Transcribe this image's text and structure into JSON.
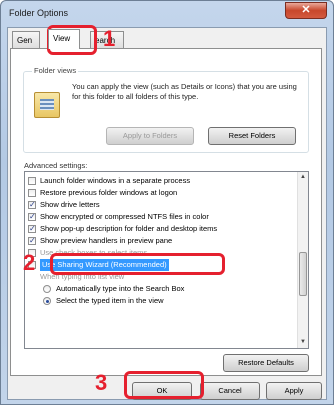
{
  "window": {
    "title": "Folder Options",
    "close_glyph": "✕"
  },
  "tabs": [
    {
      "label": "Gen"
    },
    {
      "label": "View"
    },
    {
      "label": "earch"
    }
  ],
  "folder_views": {
    "label": "Folder views",
    "description": "You can apply the view (such as Details or Icons) that you are using for this folder to all folders of this type.",
    "apply_button": "Apply to Folders",
    "reset_button": "Reset Folders"
  },
  "advanced": {
    "label": "Advanced settings:",
    "rows": [
      {
        "text": "Launch folder windows in a separate process",
        "checked": false
      },
      {
        "text": "Restore previous folder windows at logon",
        "checked": false
      },
      {
        "text": "Show drive letters",
        "checked": true
      },
      {
        "text": "Show encrypted or compressed NTFS files in color",
        "checked": true
      },
      {
        "text": "Show pop-up description for folder and desktop items",
        "checked": true
      },
      {
        "text": "Show preview handlers in preview pane",
        "checked": true
      },
      {
        "text": "Use check boxes to select items",
        "checked": false
      },
      {
        "text": "Use Sharing Wizard (Recommended)",
        "checked": false
      },
      {
        "text": "When typing into list view"
      },
      {
        "text": "Automatically type into the Search Box",
        "selected": false
      },
      {
        "text": "Select the typed item in the view",
        "selected": true
      }
    ],
    "check_glyph": "✓"
  },
  "restore_button": "Restore Defaults",
  "footer": {
    "ok": "OK",
    "cancel": "Cancel",
    "apply": "Apply"
  },
  "annotations": [
    "1",
    "2",
    "3"
  ],
  "colors": {
    "callout": "#e5202e",
    "selection": "#3399ff"
  }
}
